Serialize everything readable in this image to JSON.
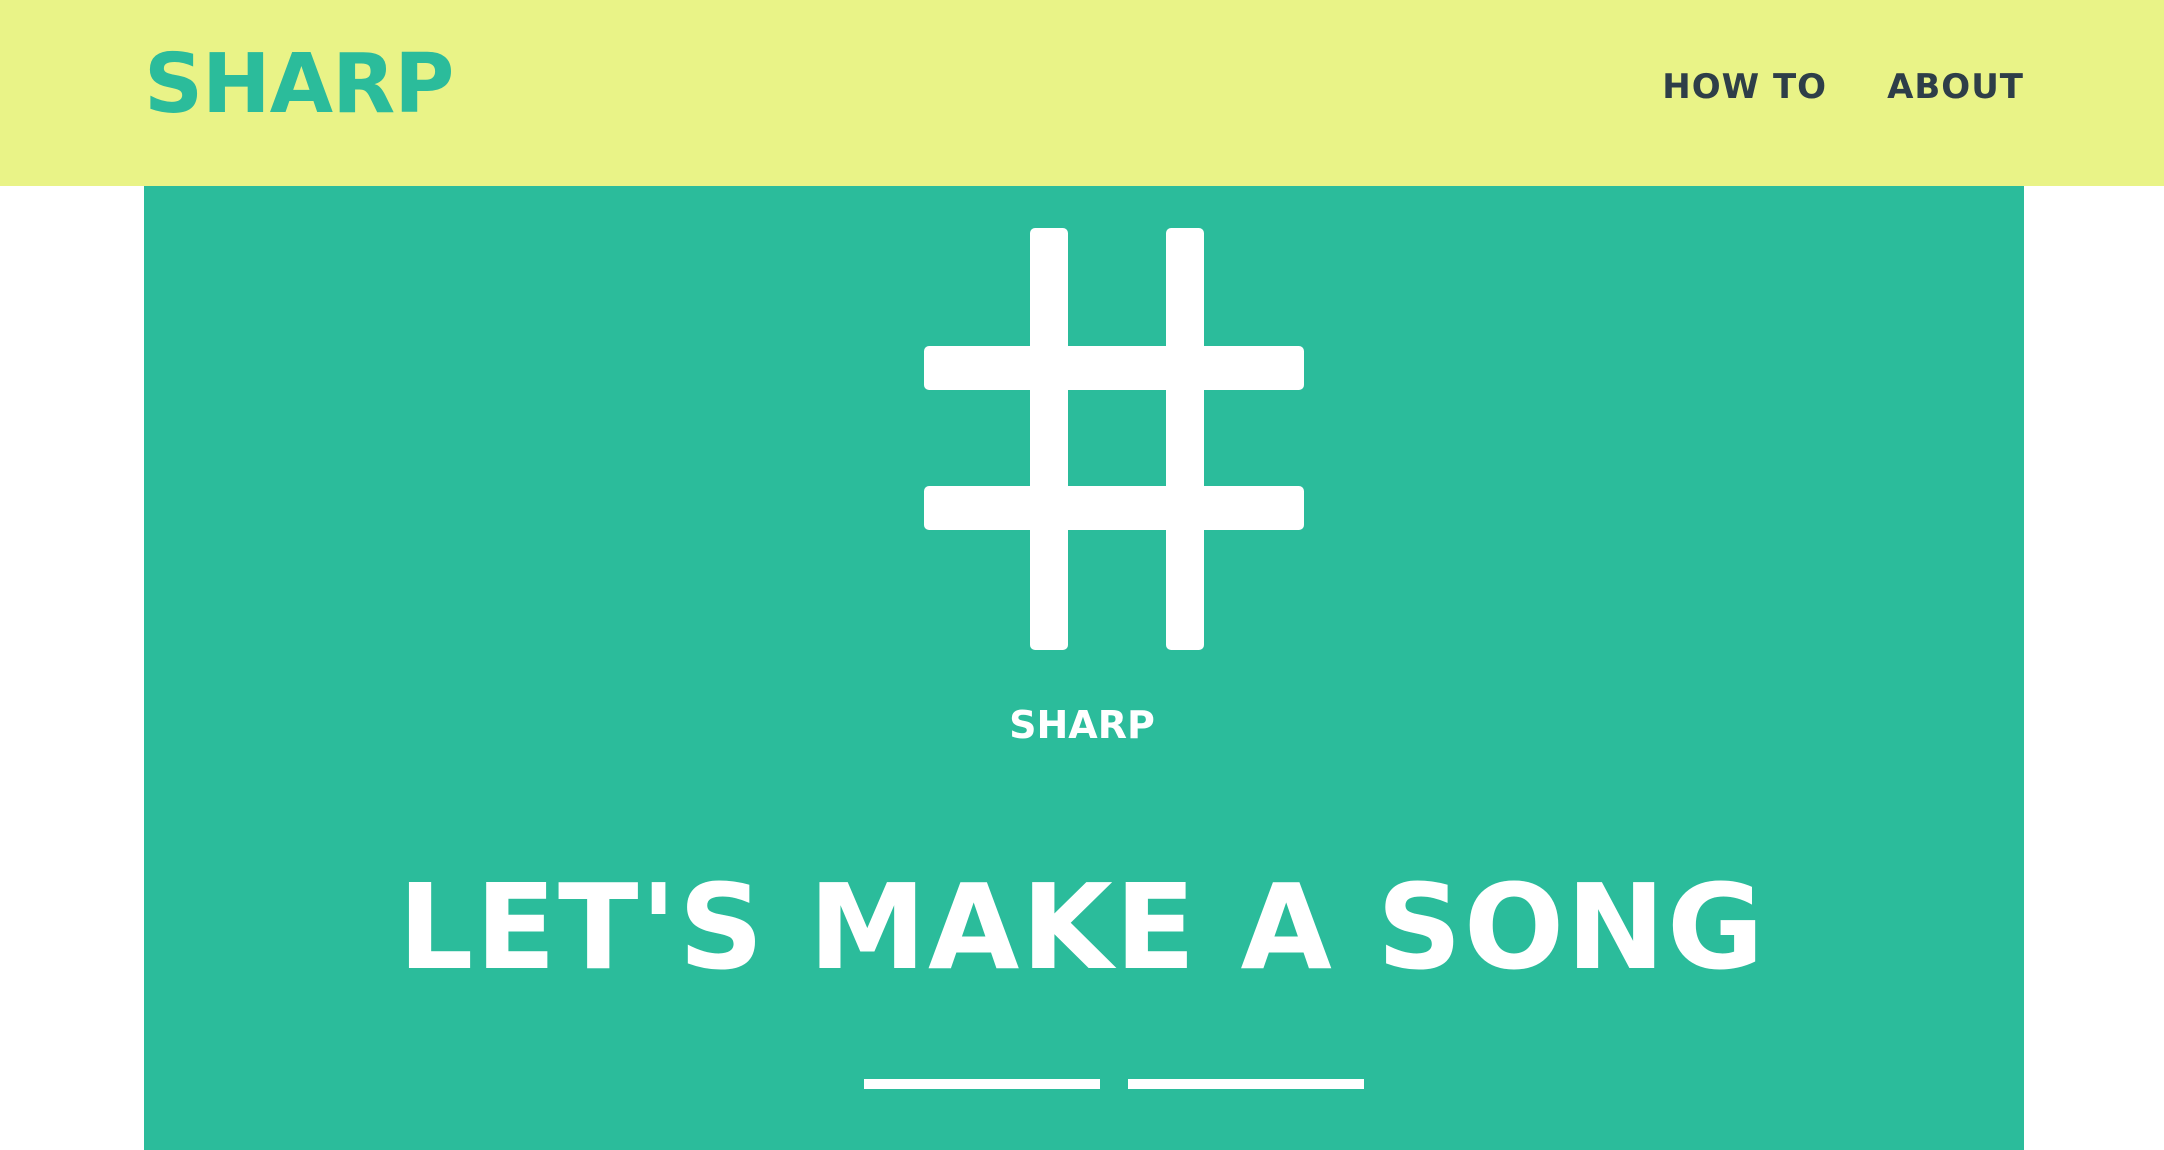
{
  "header": {
    "brand": "SHARP",
    "nav": [
      {
        "label": "HOW TO"
      },
      {
        "label": "ABOUT"
      }
    ]
  },
  "hero": {
    "logo_icon": "sharp-symbol-icon",
    "label": "SHARP",
    "title": "LET'S MAKE A SONG"
  },
  "colors": {
    "topbar_bg": "#e9f387",
    "accent": "#2bbc9b",
    "nav_text": "#2e3e48",
    "hero_text": "#ffffff"
  }
}
